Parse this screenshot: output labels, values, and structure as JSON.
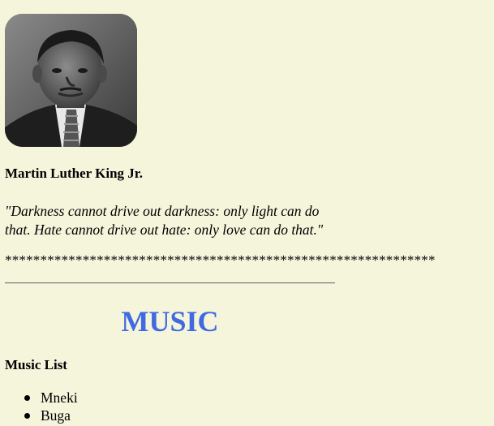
{
  "profile": {
    "name": "Martin Luther King Jr.",
    "quote": "\"Darkness cannot drive out darkness: only light can do that. Hate cannot drive out hate: only love can do that.\"",
    "separator": "*************************************************************"
  },
  "music": {
    "heading": "MUSIC",
    "list_title": "Music List",
    "items": [
      "Mneki",
      "Buga"
    ]
  },
  "colors": {
    "background": "#f5f5dc",
    "heading": "#4169e1"
  }
}
